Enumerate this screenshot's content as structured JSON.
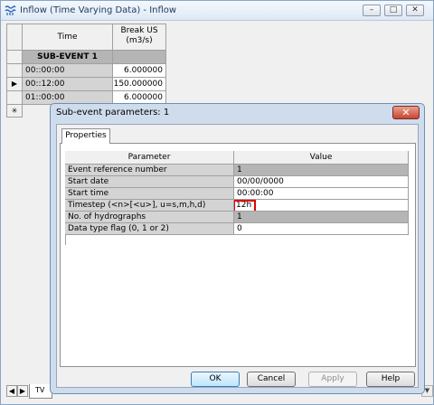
{
  "window": {
    "title": "Inflow (Time Varying Data) - Inflow",
    "controls": {
      "minimize": "–",
      "maximize": "□",
      "close": "✕"
    }
  },
  "grid": {
    "headers": {
      "time": "Time",
      "value": "Break US\n(m3/s)"
    },
    "subevent_label": "SUB-EVENT 1",
    "rows": [
      {
        "time": "00::00:00",
        "value": "6.000000",
        "marker": ""
      },
      {
        "time": "00::12:00",
        "value": "150.000000",
        "marker": "▶"
      },
      {
        "time": "01::00:00",
        "value": "6.000000",
        "marker": ""
      }
    ],
    "new_row_marker": "✳"
  },
  "sheet_tabs": {
    "nav_prev": "◀",
    "nav_next": "▶",
    "active": "TV"
  },
  "dialog": {
    "title": "Sub-event parameters: 1",
    "close": "✕",
    "tab_label": "Properties",
    "table": {
      "headers": {
        "parameter": "Parameter",
        "value": "Value"
      },
      "rows": [
        {
          "name": "Event reference number",
          "value": "1",
          "readonly": true
        },
        {
          "name": "Start date",
          "value": "00/00/0000",
          "readonly": false
        },
        {
          "name": "Start time",
          "value": "00:00:00",
          "readonly": false
        },
        {
          "name": "Timestep (<n>[<u>], u=s,m,h,d)",
          "value": "12h",
          "readonly": false,
          "highlighted": true
        },
        {
          "name": "No. of hydrographs",
          "value": "1",
          "readonly": true
        },
        {
          "name": "Data type flag (0, 1 or 2)",
          "value": "0",
          "readonly": false
        }
      ]
    },
    "buttons": {
      "ok": "OK",
      "cancel": "Cancel",
      "apply": "Apply",
      "help": "Help"
    }
  },
  "colors": {
    "highlight_box": "#e00000",
    "readonly_cell": "#b5b5b5",
    "header_cell": "#f0f0f0"
  }
}
